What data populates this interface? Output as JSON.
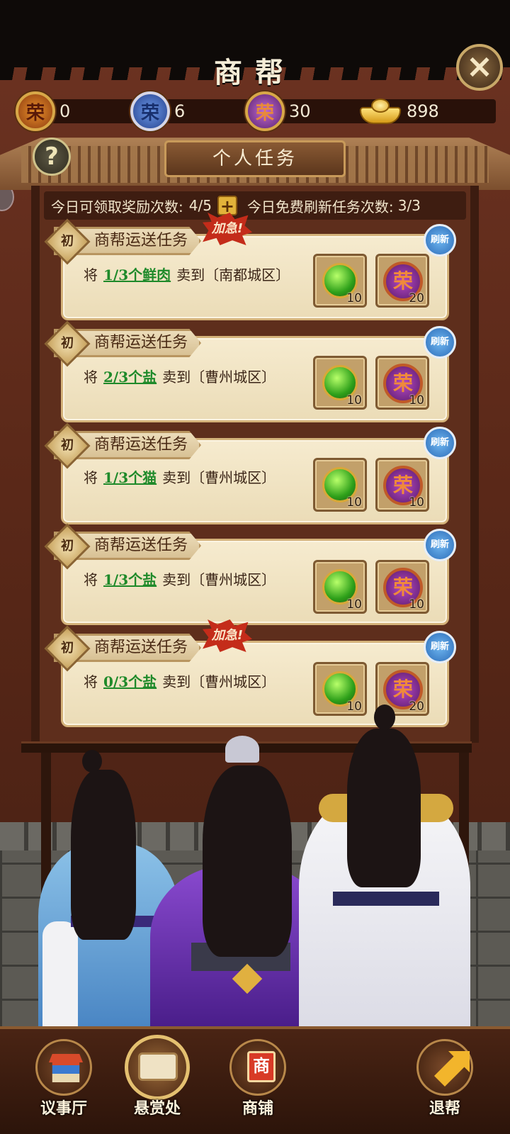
{
  "header": {
    "title": "商帮",
    "close_icon": "close-x-icon"
  },
  "currencies": [
    {
      "icon": "honor-orange-medal",
      "glyph": "荣",
      "value": "0"
    },
    {
      "icon": "honor-blue-medal",
      "glyph": "荣",
      "value": "6"
    },
    {
      "icon": "honor-purple-medal",
      "glyph": "荣",
      "value": "30"
    },
    {
      "icon": "gold-ingot",
      "glyph": "",
      "value": "898"
    }
  ],
  "tab": {
    "label": "个人任务",
    "help_glyph": "?"
  },
  "info": {
    "reward_label": "今日可领取奖励次数:",
    "reward_count": "4/5",
    "plus_glyph": "+",
    "refresh_label": "今日免费刷新任务次数:",
    "refresh_count": "3/3"
  },
  "tasks": [
    {
      "rank": "初",
      "title": "商帮运送任务",
      "urgent": "加急!",
      "prefix": "将",
      "qty": "1/3个鲜肉",
      "verb": "卖到",
      "dest": "〔南都城区〕",
      "refresh": "刷新",
      "reward1_count": "10",
      "reward2_count": "20"
    },
    {
      "rank": "初",
      "title": "商帮运送任务",
      "urgent": "",
      "prefix": "将",
      "qty": "2/3个盐",
      "verb": "卖到",
      "dest": "〔曹州城区〕",
      "refresh": "刷新",
      "reward1_count": "10",
      "reward2_count": "10"
    },
    {
      "rank": "初",
      "title": "商帮运送任务",
      "urgent": "",
      "prefix": "将",
      "qty": "1/3个猫",
      "verb": "卖到",
      "dest": "〔曹州城区〕",
      "refresh": "刷新",
      "reward1_count": "10",
      "reward2_count": "10"
    },
    {
      "rank": "初",
      "title": "商帮运送任务",
      "urgent": "",
      "prefix": "将",
      "qty": "1/3个盐",
      "verb": "卖到",
      "dest": "〔曹州城区〕",
      "refresh": "刷新",
      "reward1_count": "10",
      "reward2_count": "10"
    },
    {
      "rank": "初",
      "title": "商帮运送任务",
      "urgent": "加急!",
      "prefix": "将",
      "qty": "0/3个盐",
      "verb": "卖到",
      "dest": "〔曹州城区〕",
      "refresh": "刷新",
      "reward1_count": "10",
      "reward2_count": "20"
    }
  ],
  "reward_glyph": "荣",
  "nav": [
    {
      "label": "议事厅",
      "icon": "council-hall-icon"
    },
    {
      "label": "悬赏处",
      "icon": "bounty-scroll-icon"
    },
    {
      "label": "商铺",
      "icon": "shop-sign-icon",
      "glyph": "商"
    },
    {
      "label": "退帮",
      "icon": "exit-arrow-icon"
    }
  ]
}
